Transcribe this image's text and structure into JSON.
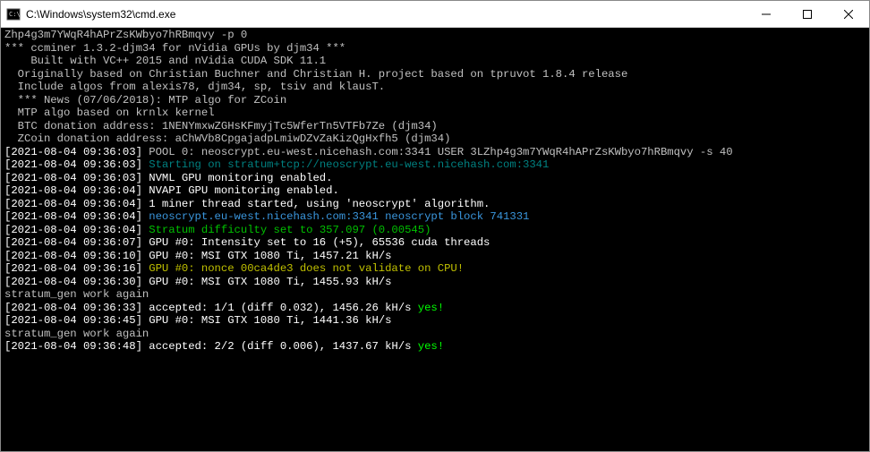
{
  "titlebar": {
    "title": "C:\\Windows\\system32\\cmd.exe"
  },
  "lines": [
    {
      "segs": [
        {
          "cls": "gray",
          "t": "Zhp4g3m7YWqR4hAPrZsKWbyo7hRBmqvy -p 0"
        }
      ]
    },
    {
      "segs": [
        {
          "cls": "gray",
          "t": "*** ccminer 1.3.2-djm34 for nVidia GPUs by djm34 ***"
        }
      ]
    },
    {
      "segs": [
        {
          "cls": "gray",
          "t": "    Built with VC++ 2015 and nVidia CUDA SDK 11.1"
        }
      ]
    },
    {
      "segs": [
        {
          "cls": "gray",
          "t": ""
        }
      ]
    },
    {
      "segs": [
        {
          "cls": "gray",
          "t": "  Originally based on Christian Buchner and Christian H. project based on tpruvot 1.8.4 release"
        }
      ]
    },
    {
      "segs": [
        {
          "cls": "gray",
          "t": "  Include algos from alexis78, djm34, sp, tsiv and klausT."
        }
      ]
    },
    {
      "segs": [
        {
          "cls": "gray",
          "t": "  *** News (07/06/2018): MTP algo for ZCoin"
        }
      ]
    },
    {
      "segs": [
        {
          "cls": "gray",
          "t": ""
        }
      ]
    },
    {
      "segs": [
        {
          "cls": "gray",
          "t": "  MTP algo based on krnlx kernel"
        }
      ]
    },
    {
      "segs": [
        {
          "cls": "gray",
          "t": ""
        }
      ]
    },
    {
      "segs": [
        {
          "cls": "gray",
          "t": "  BTC donation address: 1NENYmxwZGHsKFmyjTc5WferTn5VTFb7Ze (djm34)"
        }
      ]
    },
    {
      "segs": [
        {
          "cls": "gray",
          "t": "  ZCoin donation address: aChWVb8CpgajadpLmiwDZvZaKizQgHxfh5 (djm34)"
        }
      ]
    },
    {
      "segs": [
        {
          "cls": "gray",
          "t": ""
        }
      ]
    },
    {
      "segs": [
        {
          "cls": "white",
          "t": "[2021-08-04 09:36:03] "
        },
        {
          "cls": "gray",
          "t": "POOL 0: neoscrypt.eu-west.nicehash.com:3341 USER 3LZhp4g3m7YWqR4hAPrZsKWbyo7hRBmqvy -s 40"
        }
      ]
    },
    {
      "segs": [
        {
          "cls": "white",
          "t": "[2021-08-04 09:36:03] "
        },
        {
          "cls": "darkcyan",
          "t": "Starting on stratum+tcp://neoscrypt.eu-west.nicehash.com:3341"
        }
      ]
    },
    {
      "segs": [
        {
          "cls": "white",
          "t": "[2021-08-04 09:36:03] NVML GPU monitoring enabled."
        }
      ]
    },
    {
      "segs": [
        {
          "cls": "white",
          "t": "[2021-08-04 09:36:04] NVAPI GPU monitoring enabled."
        }
      ]
    },
    {
      "segs": [
        {
          "cls": "white",
          "t": "[2021-08-04 09:36:04] 1 miner thread started, using 'neoscrypt' algorithm."
        }
      ]
    },
    {
      "segs": [
        {
          "cls": "white",
          "t": "[2021-08-04 09:36:04] "
        },
        {
          "cls": "cyan",
          "t": "neoscrypt.eu-west.nicehash.com:3341 neoscrypt block 741331"
        }
      ]
    },
    {
      "segs": [
        {
          "cls": "white",
          "t": "[2021-08-04 09:36:04] "
        },
        {
          "cls": "darkgreen",
          "t": "Stratum difficulty set to 357.097 (0.00545)"
        }
      ]
    },
    {
      "segs": [
        {
          "cls": "white",
          "t": "[2021-08-04 09:36:07] GPU #0: Intensity set to 16 (+5), 65536 cuda threads"
        }
      ]
    },
    {
      "segs": [
        {
          "cls": "white",
          "t": "[2021-08-04 09:36:10] GPU #0: MSI GTX 1080 Ti, 1457.21 kH/s"
        }
      ]
    },
    {
      "segs": [
        {
          "cls": "white",
          "t": "[2021-08-04 09:36:16] "
        },
        {
          "cls": "yellow",
          "t": "GPU #0: nonce 00ca4de3 does not validate on CPU!"
        }
      ]
    },
    {
      "segs": [
        {
          "cls": "white",
          "t": "[2021-08-04 09:36:30] GPU #0: MSI GTX 1080 Ti, 1455.93 kH/s"
        }
      ]
    },
    {
      "segs": [
        {
          "cls": "gray",
          "t": "stratum_gen work again"
        }
      ]
    },
    {
      "segs": [
        {
          "cls": "white",
          "t": "[2021-08-04 09:36:33] accepted: 1/1 (diff 0.032), 1456.26 kH/s "
        },
        {
          "cls": "green",
          "t": "yes!"
        }
      ]
    },
    {
      "segs": [
        {
          "cls": "white",
          "t": "[2021-08-04 09:36:45] GPU #0: MSI GTX 1080 Ti, 1441.36 kH/s"
        }
      ]
    },
    {
      "segs": [
        {
          "cls": "gray",
          "t": "stratum_gen work again"
        }
      ]
    },
    {
      "segs": [
        {
          "cls": "white",
          "t": "[2021-08-04 09:36:48] accepted: 2/2 (diff 0.006), 1437.67 kH/s "
        },
        {
          "cls": "green",
          "t": "yes!"
        }
      ]
    }
  ]
}
